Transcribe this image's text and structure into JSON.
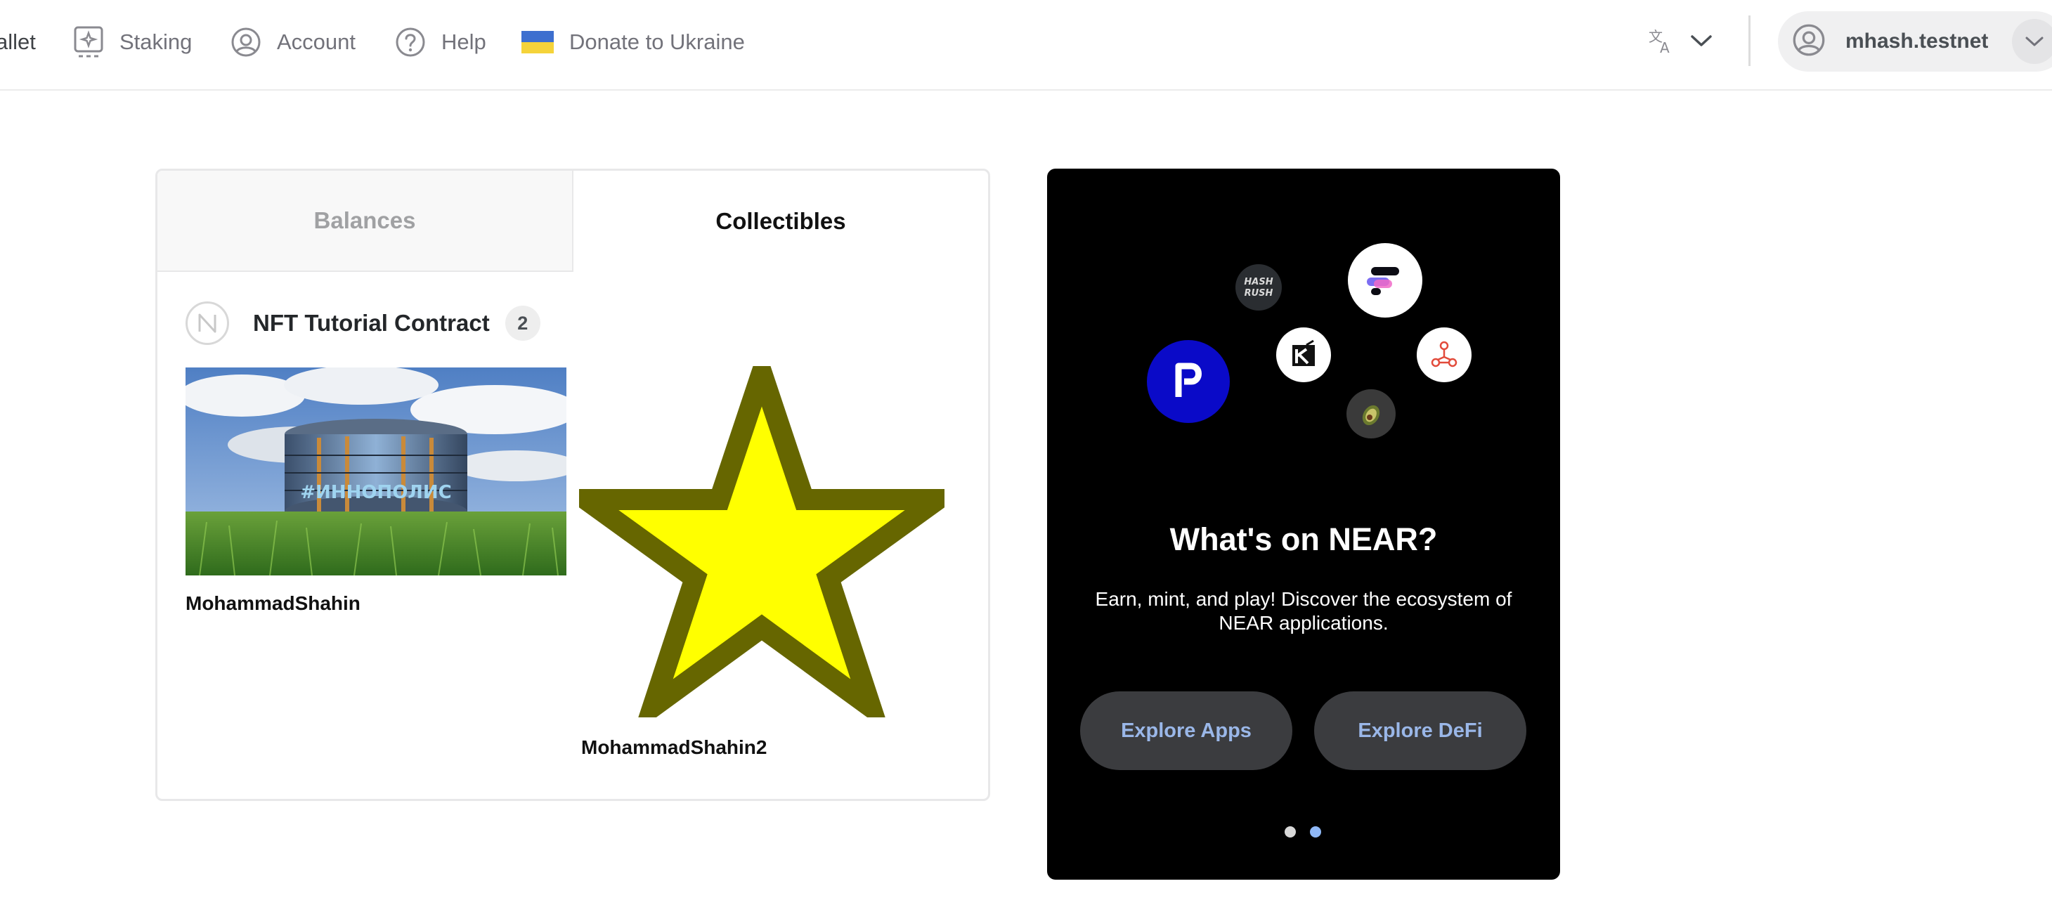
{
  "nav": {
    "wallet_label": "allet",
    "staking_label": "Staking",
    "account_label": "Account",
    "help_label": "Help",
    "ukraine_label": "Donate to Ukraine",
    "account_name": "mhash.testnet"
  },
  "tabs": {
    "balances": "Balances",
    "collectibles": "Collectibles"
  },
  "contract": {
    "title": "NFT Tutorial Contract",
    "count": "2"
  },
  "nfts": [
    {
      "title": "MohammadShahin",
      "image_caption": "#ИННОПОЛИС"
    },
    {
      "title": "MohammadShahin2"
    }
  ],
  "promo": {
    "title": "What's on NEAR?",
    "subtitle": "Earn, mint, and play! Discover the ecosystem of NEAR applications.",
    "explore_apps": "Explore Apps",
    "explore_defi": "Explore DeFi",
    "hash_rush_text": "HASH RUSH"
  },
  "colors": {
    "accent": "#9ab7e8",
    "promo_bg": "#000000",
    "star_fill": "#ffff00",
    "star_stroke": "#666600",
    "pagination_active": "#8fb8f6"
  },
  "icons": [
    "wallet-icon",
    "staking-icon",
    "account-icon",
    "help-icon",
    "ukraine-flag-icon",
    "translate-icon",
    "chevron-down-icon",
    "user-avatar-icon",
    "near-logo-icon"
  ]
}
